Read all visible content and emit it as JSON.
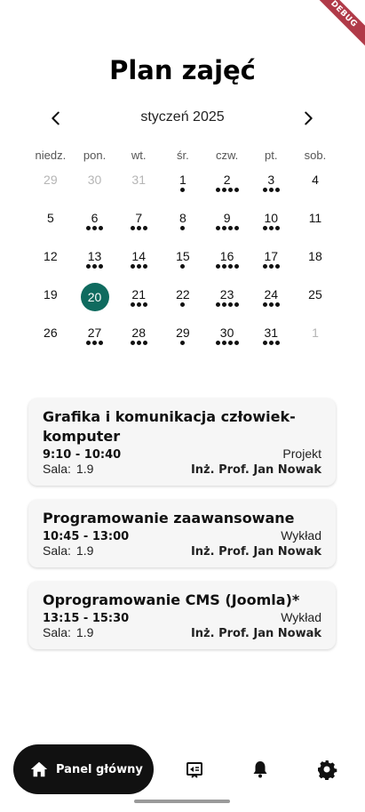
{
  "debug_banner": "DEBUG",
  "title": "Plan zajęć",
  "calendar": {
    "month_label": "styczeń 2025",
    "weekdays": [
      "niedz.",
      "pon.",
      "wt.",
      "śr.",
      "czw.",
      "pt.",
      "sob."
    ],
    "weeks": [
      [
        {
          "day": "29",
          "outside": true,
          "dots": 0
        },
        {
          "day": "30",
          "outside": true,
          "dots": 0
        },
        {
          "day": "31",
          "outside": true,
          "dots": 0
        },
        {
          "day": "1",
          "dots": 1
        },
        {
          "day": "2",
          "dots": 4
        },
        {
          "day": "3",
          "dots": 3
        },
        {
          "day": "4",
          "dots": 0
        }
      ],
      [
        {
          "day": "5",
          "dots": 0
        },
        {
          "day": "6",
          "dots": 3
        },
        {
          "day": "7",
          "dots": 3
        },
        {
          "day": "8",
          "dots": 1
        },
        {
          "day": "9",
          "dots": 4
        },
        {
          "day": "10",
          "dots": 3
        },
        {
          "day": "11",
          "dots": 0
        }
      ],
      [
        {
          "day": "12",
          "dots": 0
        },
        {
          "day": "13",
          "dots": 3
        },
        {
          "day": "14",
          "dots": 3
        },
        {
          "day": "15",
          "dots": 1
        },
        {
          "day": "16",
          "dots": 4
        },
        {
          "day": "17",
          "dots": 3
        },
        {
          "day": "18",
          "dots": 0
        }
      ],
      [
        {
          "day": "19",
          "dots": 0
        },
        {
          "day": "20",
          "selected": true,
          "dots": 0
        },
        {
          "day": "21",
          "dots": 3
        },
        {
          "day": "22",
          "dots": 1
        },
        {
          "day": "23",
          "dots": 4
        },
        {
          "day": "24",
          "dots": 3
        },
        {
          "day": "25",
          "dots": 0
        }
      ],
      [
        {
          "day": "26",
          "dots": 0
        },
        {
          "day": "27",
          "dots": 3
        },
        {
          "day": "28",
          "dots": 3
        },
        {
          "day": "29",
          "dots": 1
        },
        {
          "day": "30",
          "dots": 4
        },
        {
          "day": "31",
          "dots": 3
        },
        {
          "day": "1",
          "outside": true,
          "dots": 0
        }
      ]
    ],
    "selected_color": "#0f6b5f"
  },
  "classes": [
    {
      "name": "Grafika i komunikacja człowiek-komputer",
      "time": "9:10 - 10:40",
      "type": "Projekt",
      "room_label": "Sala:",
      "room": "1.9",
      "teacher": "Inż. Prof. Jan Nowak"
    },
    {
      "name": "Programowanie zaawansowane",
      "time": "10:45 - 13:00",
      "type": "Wykład",
      "room_label": "Sala:",
      "room": "1.9",
      "teacher": "Inż. Prof. Jan Nowak"
    },
    {
      "name": "Oprogramowanie CMS (Joomla)*",
      "time": "13:15 - 15:30",
      "type": "Wykład",
      "room_label": "Sala:",
      "room": "1.9",
      "teacher": "Inż. Prof. Jan Nowak"
    }
  ],
  "bottom_nav": {
    "home_label": "Panel główny",
    "icons": [
      "home-icon",
      "schedule-icon",
      "bell-icon",
      "gear-icon"
    ]
  }
}
